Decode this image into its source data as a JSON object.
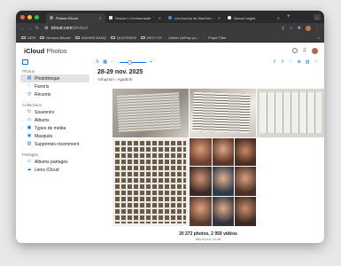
{
  "browser": {
    "tabs": [
      {
        "label": "Photos iCloud",
        "active": true,
        "favicon_color": "#8e8e93"
      },
      {
        "label": "Gosner | Communauté",
        "active": false,
        "favicon_color": "#e8e8e8"
      },
      {
        "label": "Les forums de MacGen...",
        "active": false,
        "favicon_color": "#4a90d9"
      },
      {
        "label": "Nouvel onglet",
        "active": false,
        "favicon_color": "#ffffff"
      }
    ],
    "url_host": "icloud.com",
    "url_path": "/photos/",
    "bookmarks": [
      {
        "label": "NEW"
      },
      {
        "label": "Devises Bitcoin"
      },
      {
        "label": "ADMINS BANQ"
      },
      {
        "label": "QUOTIDIEN"
      },
      {
        "label": "BEST OF"
      },
      {
        "label": "Utiliser AirPlay po..."
      },
      {
        "label": "Projet Titan"
      }
    ],
    "bookmarks_overflow": "»"
  },
  "app": {
    "brand": "iCloud",
    "product": "Photos"
  },
  "sidebar": {
    "section_photos": "Photos",
    "photos_items": [
      {
        "label": "Photothèque",
        "selected": true,
        "icon": "photo-library-icon",
        "glyph": "▤"
      },
      {
        "label": "Favoris",
        "selected": false,
        "icon": "heart-icon",
        "glyph": "♡"
      },
      {
        "label": "Récents",
        "selected": false,
        "icon": "clock-icon",
        "glyph": "◷"
      }
    ],
    "section_collections": "Collections",
    "collections_items": [
      {
        "label": "Souvenirs",
        "icon": "memories-icon",
        "glyph": "↻",
        "chevron": false
      },
      {
        "label": "Albums",
        "icon": "albums-icon",
        "glyph": "▭",
        "chevron": true
      },
      {
        "label": "Types de média",
        "icon": "media-types-icon",
        "glyph": "▣",
        "chevron": true
      },
      {
        "label": "Masqués",
        "icon": "eye-icon",
        "glyph": "◉",
        "chevron": false
      },
      {
        "label": "Supprimés récemment",
        "icon": "trash-icon",
        "glyph": "▥",
        "chevron": false
      }
    ],
    "section_sharing": "Partagés",
    "sharing_items": [
      {
        "label": "Albums partagés",
        "icon": "shared-albums-icon",
        "glyph": "▭",
        "chevron": true
      },
      {
        "label": "Liens iCloud",
        "icon": "cloud-icon",
        "glyph": "☁",
        "chevron": false
      }
    ]
  },
  "main": {
    "date_title": "28-29 nov. 2025",
    "place": "Ashqelon - Agadmh",
    "count": "20 272 photos, 2 959 vidéos",
    "updated": "Mis à jour 12:48"
  }
}
